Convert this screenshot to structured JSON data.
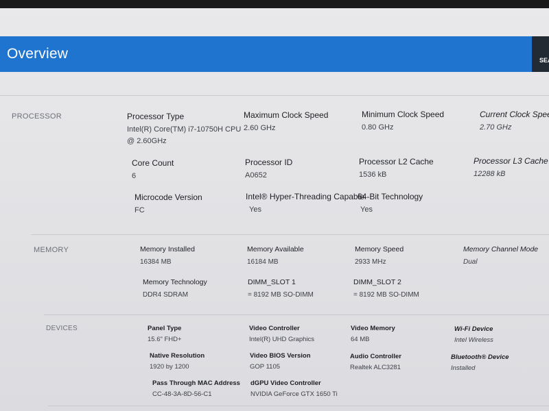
{
  "page": {
    "title": "Overview",
    "search_label": "SEA"
  },
  "processor": {
    "section": "PROCESSOR",
    "fields": [
      {
        "label": "Processor Type",
        "value": "Intel(R) Core(TM) i7-10750H CPU",
        "value2": "@ 2.60GHz"
      },
      {
        "label": "Maximum Clock Speed",
        "value": "2.60 GHz"
      },
      {
        "label": "Minimum Clock Speed",
        "value": "0.80 GHz"
      },
      {
        "label": "Current Clock Speed",
        "value": "2.70 GHz"
      },
      {
        "label": "Core Count",
        "value": "6"
      },
      {
        "label": "Processor ID",
        "value": "A0652"
      },
      {
        "label": "Processor L2 Cache",
        "value": "1536 kB"
      },
      {
        "label": "Processor L3 Cache",
        "value": "12288 kB"
      },
      {
        "label": "Microcode Version",
        "value": "FC"
      },
      {
        "label": "Intel® Hyper-Threading Capable",
        "value": "Yes"
      },
      {
        "label": "64-Bit Technology",
        "value": "Yes"
      }
    ]
  },
  "memory": {
    "section": "MEMORY",
    "fields": [
      {
        "label": "Memory Installed",
        "value": "16384 MB"
      },
      {
        "label": "Memory Available",
        "value": "16184 MB"
      },
      {
        "label": "Memory Speed",
        "value": "2933 MHz"
      },
      {
        "label": "Memory Channel Mode",
        "value": "Dual"
      },
      {
        "label": "Memory Technology",
        "value": "DDR4 SDRAM"
      },
      {
        "label": "DIMM_SLOT 1",
        "value": "= 8192 MB SO-DIMM"
      },
      {
        "label": "DIMM_SLOT 2",
        "value": "= 8192 MB SO-DIMM"
      }
    ]
  },
  "devices": {
    "section": "DEVICES",
    "fields": [
      {
        "label": "Panel Type",
        "value": "15.6\" FHD+"
      },
      {
        "label": "Video Controller",
        "value": "Intel(R) UHD Graphics"
      },
      {
        "label": "Video Memory",
        "value": "64 MB"
      },
      {
        "label": "Wi-Fi Device",
        "value": "Intel Wireless"
      },
      {
        "label": "Native Resolution",
        "value": "1920 by 1200"
      },
      {
        "label": "Video BIOS Version",
        "value": "GOP 1105"
      },
      {
        "label": "Audio Controller",
        "value": "Realtek ALC3281"
      },
      {
        "label": "Bluetooth® Device",
        "value": "Installed"
      },
      {
        "label": "Pass Through MAC Address",
        "value": "CC-48-3A-8D-56-C1"
      },
      {
        "label": "dGPU Video Controller",
        "value": "NVIDIA GeForce GTX 1650 Ti"
      }
    ]
  }
}
